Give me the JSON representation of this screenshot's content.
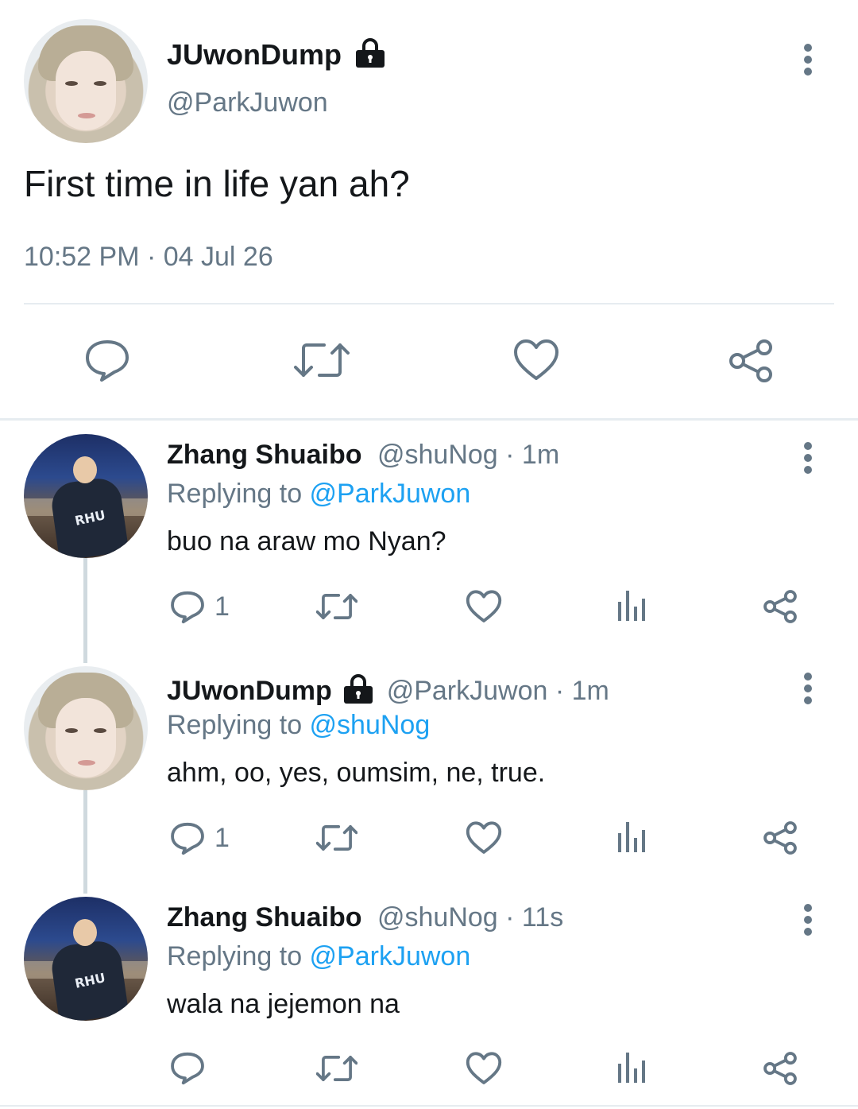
{
  "main_tweet": {
    "author": {
      "display_name": "JUwonDump",
      "handle": "@ParkJuwon",
      "protected": true
    },
    "text": "First time in life yan ah?",
    "timestamp": "10:52 PM · 04 Jul 26",
    "actions": [
      "reply-icon",
      "retweet-icon",
      "like-icon",
      "share-icon"
    ]
  },
  "replies": [
    {
      "display_name": "Zhang Shuaibo",
      "handle_time": "@shuNog · 1m",
      "replying_prefix": "Replying to ",
      "replying_to": "@ParkJuwon",
      "text": "buo na araw mo Nyan?",
      "reply_count": "1",
      "avatar_text": "RHU\nCOTU"
    },
    {
      "display_name": "JUwonDump",
      "protected": true,
      "handle_time": "@ParkJuwon · 1m",
      "replying_prefix": "Replying to ",
      "replying_to": "@shuNog",
      "text": "ahm, oo, yes, oumsim, ne, true.",
      "reply_count": "1"
    },
    {
      "display_name": "Zhang Shuaibo",
      "handle_time": "@shuNog · 11s",
      "replying_prefix": "Replying to ",
      "replying_to": "@ParkJuwon",
      "text": "wala na jejemon na",
      "reply_count": ""
    }
  ],
  "colors": {
    "accent": "#1da1f2",
    "muted": "#657786",
    "text": "#14171a",
    "divider": "#e6ecf0"
  }
}
